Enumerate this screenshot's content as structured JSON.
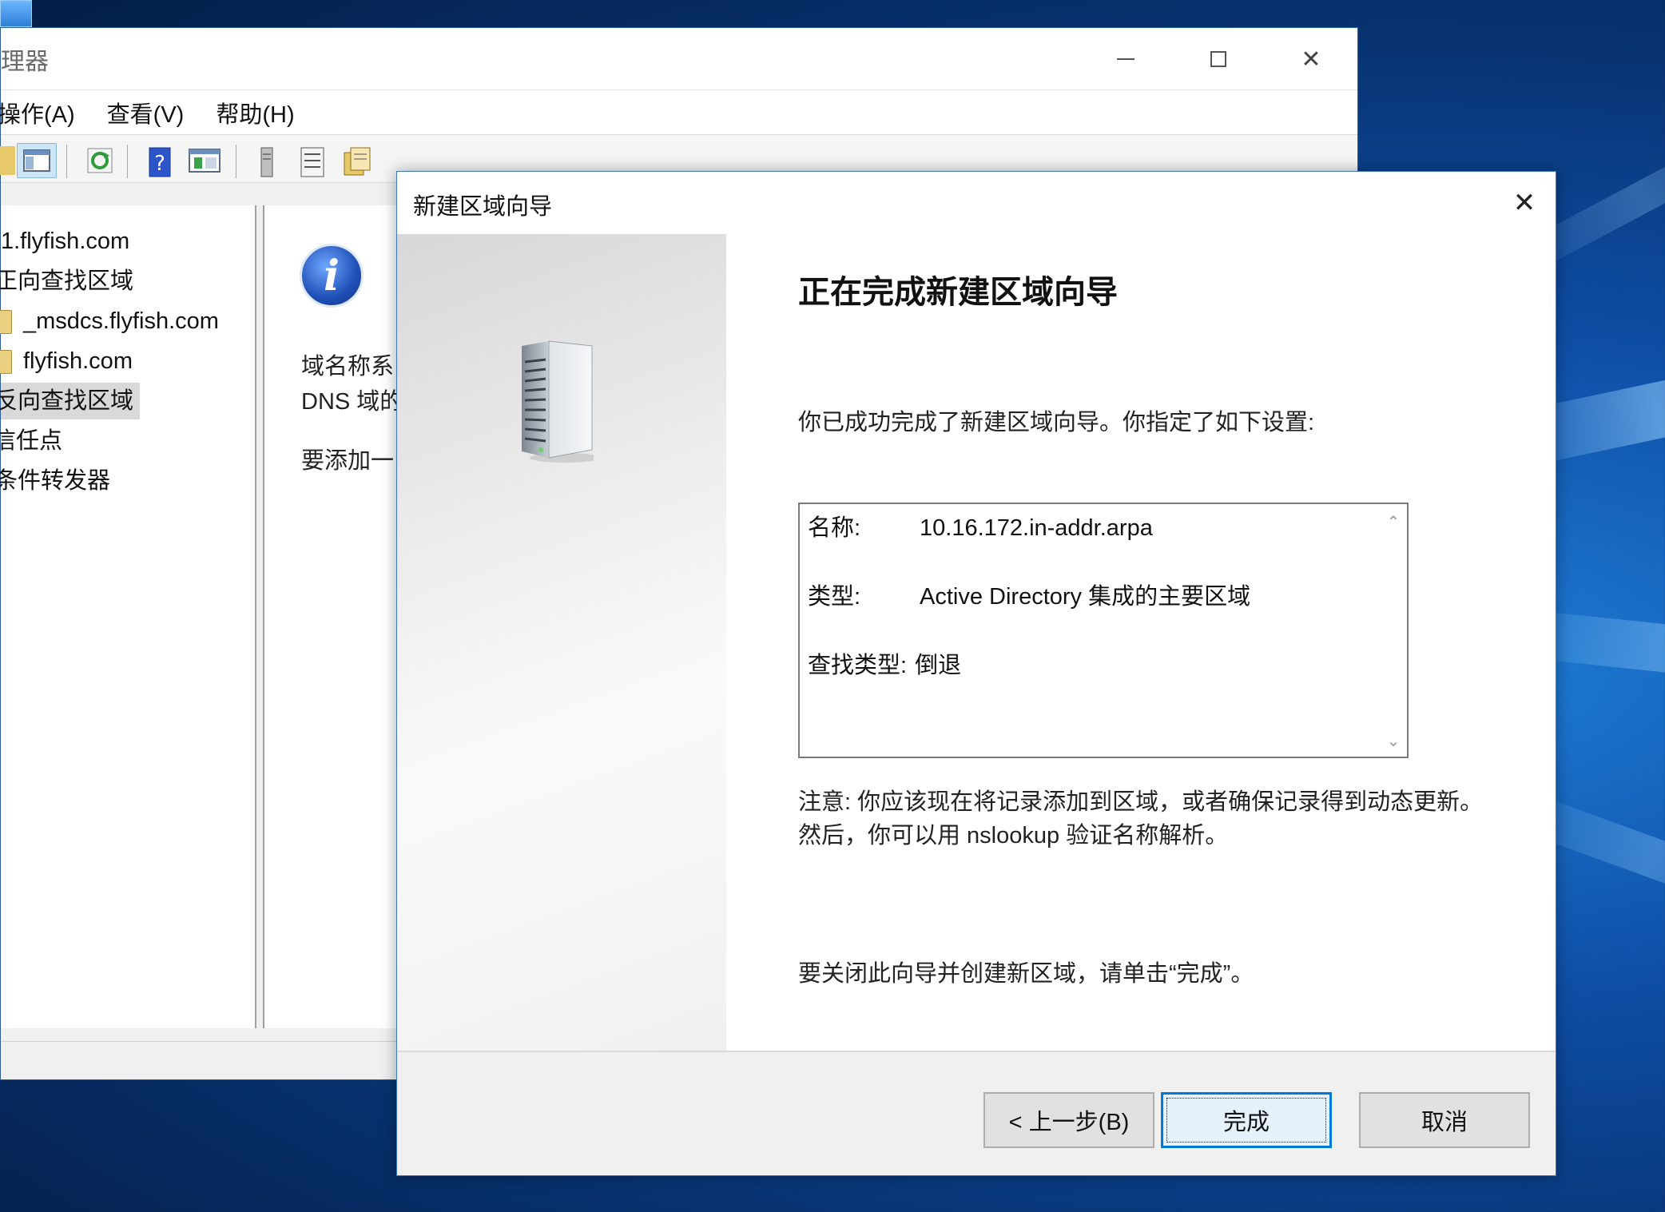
{
  "mmc": {
    "title": "理器",
    "menu": [
      "操作(A)",
      "查看(V)",
      "帮助(H)"
    ],
    "tree": [
      {
        "label": "1.flyfish.com",
        "selected": false
      },
      {
        "label": "正向查找区域",
        "selected": false
      },
      {
        "label": "_msdcs.flyfish.com",
        "selected": false
      },
      {
        "label": "flyfish.com",
        "selected": false
      },
      {
        "label": "反向查找区域",
        "selected": true
      },
      {
        "label": "信任点",
        "selected": false
      },
      {
        "label": "条件转发器",
        "selected": false
      }
    ],
    "detail": {
      "line1": "域名称系",
      "line2": "DNS 域的",
      "line3": "要添加一"
    }
  },
  "wizard": {
    "title": "新建区域向导",
    "heading": "正在完成新建区域向导",
    "intro": "你已成功完成了新建区域向导。你指定了如下设置:",
    "summary": {
      "name_label": "名称:",
      "name_value": "10.16.172.in-addr.arpa",
      "type_label": "类型:",
      "type_value": "Active Directory 集成的主要区域",
      "lookup_label": "查找类型:",
      "lookup_value": "倒退"
    },
    "note": "注意: 你应该现在将记录添加到区域，或者确保记录得到动态更新。然后，你可以用 nslookup 验证名称解析。",
    "close_hint": "要关闭此向导并创建新区域，请单击“完成”。",
    "buttons": {
      "back": "< 上一步(B)",
      "finish": "完成",
      "cancel": "取消"
    }
  },
  "colors": {
    "accent": "#0078d7",
    "desktop": "#0e4ea6"
  }
}
